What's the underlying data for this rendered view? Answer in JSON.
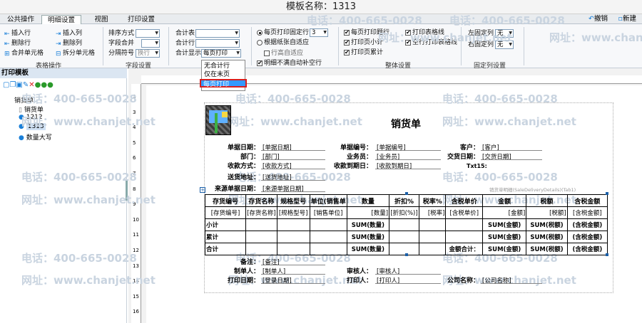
{
  "window": {
    "title": "模板名称：1313"
  },
  "tabs": [
    "公共操作",
    "明细设置",
    "视图",
    "打印设置"
  ],
  "topright": {
    "undo": "撤销",
    "new": "新建"
  },
  "ribbon": {
    "table_ops": {
      "insert_row": "插入行",
      "insert_col": "插入列",
      "delete_row": "删除行",
      "delete_col": "删除列",
      "merge": "合并单元格",
      "split": "拆分单元格",
      "group": "表格操作"
    },
    "field_settings": {
      "sort_label": "排序方式",
      "field_merge": "字段合并",
      "sep_label": "分隔符号",
      "sep_value": "换行",
      "group": "字段设置"
    },
    "total": {
      "total_table": "合计表",
      "total_row": "合计行",
      "total_display": "合计显示",
      "display_value": "每页打印"
    },
    "dropdown": [
      "无合计行",
      "仅在末页",
      "每页打印"
    ],
    "page_rows": {
      "fixed_rows": "每页打印固定行",
      "fixed_value": "3",
      "adapt": "根据纸张自适应",
      "row_height": "行高自适应",
      "autofill": "明细不满自动补空行"
    },
    "overall": {
      "print_title": "每页打印题行",
      "print_subtotal": "打印页小计",
      "print_pagetotal": "打印页累计",
      "print_border": "打印表格线",
      "blank_border": "空行打印表格线",
      "group": "整体设置"
    },
    "fixed_cols": {
      "left": "左固定列",
      "left_val": "无",
      "right": "右固定列",
      "right_val": "无",
      "group": "固定列设置"
    }
  },
  "left_panel": {
    "title": "打印模板",
    "root": "销货单",
    "items": [
      "销货单",
      "1212",
      "1313",
      "数量大写"
    ]
  },
  "watermark": {
    "phone": "电话：400-665-0028",
    "site": "网址：www.chanjet.net"
  },
  "doc": {
    "title": "销货单",
    "txt15": "Txt15:",
    "detail_caption": "销货单明细(SaleDeliveryDetails)(Tab1)",
    "header": [
      {
        "label": "单据日期：",
        "value": "[单据日期]"
      },
      {
        "label": "单据编号：",
        "value": "[单据编号]"
      },
      {
        "label": "客户：",
        "value": "[客户]"
      },
      {
        "label": "部门：",
        "value": "[部门]"
      },
      {
        "label": "业务员：",
        "value": "[业务员]"
      },
      {
        "label": "交货日期：",
        "value": "[交货日期]"
      },
      {
        "label": "收款方式：",
        "value": "[收款方式]"
      },
      {
        "label": "收款到期日：",
        "value": "[收款到期日]"
      },
      {
        "label": "送货地址：",
        "value": "[送货地址]"
      },
      {
        "label": "来源单据日期：",
        "value": "[来源单据日期]"
      }
    ],
    "table_headers": [
      "存货编号",
      "存货名称",
      "规格型号",
      "单位(销售单",
      "数量",
      "折扣%",
      "税率%",
      "含税单价",
      "金额",
      "税额",
      "含税金额"
    ],
    "table_fields": [
      "[存货编号]",
      "[存货名称]",
      "[规格型号]",
      "[销售单位]",
      "[数量]",
      "[折扣(%)]",
      "[税率]",
      "[含税单价]",
      "[金额]",
      "[税额]",
      "[含税金额]"
    ],
    "rows": [
      {
        "label": "小计",
        "qty": "SUM(数量)",
        "amt": "SUM(金额)",
        "tax": "SUM(税额)",
        "total": "(含税金额)",
        "mid": ""
      },
      {
        "label": "累计",
        "qty": "SUM(数量)",
        "amt": "SUM(金额)",
        "tax": "SUM(税额)",
        "total": "(含税金额)",
        "mid": ""
      },
      {
        "label": "合计",
        "qty": "SUM(数量)",
        "amt": "SUM(金额)",
        "tax": "SUM(税额)",
        "total": "(含税金额)",
        "mid": "金额合计："
      }
    ],
    "footer": [
      {
        "label": "备注：",
        "value": "[备注]"
      },
      {
        "label": "制单人：",
        "value": "[制单人]"
      },
      {
        "label": "审核人：",
        "value": "[审核人]"
      },
      {
        "label": "打印日期：",
        "value": "[登录日期]"
      },
      {
        "label": "打印人：",
        "value": "[打印人]"
      },
      {
        "label": "公司名称：",
        "value": "[公司名称]"
      }
    ]
  },
  "colors": {
    "accent": "#1a7fd8",
    "highlight_border": "#d81e1e",
    "select_bg": "#3399ff"
  }
}
